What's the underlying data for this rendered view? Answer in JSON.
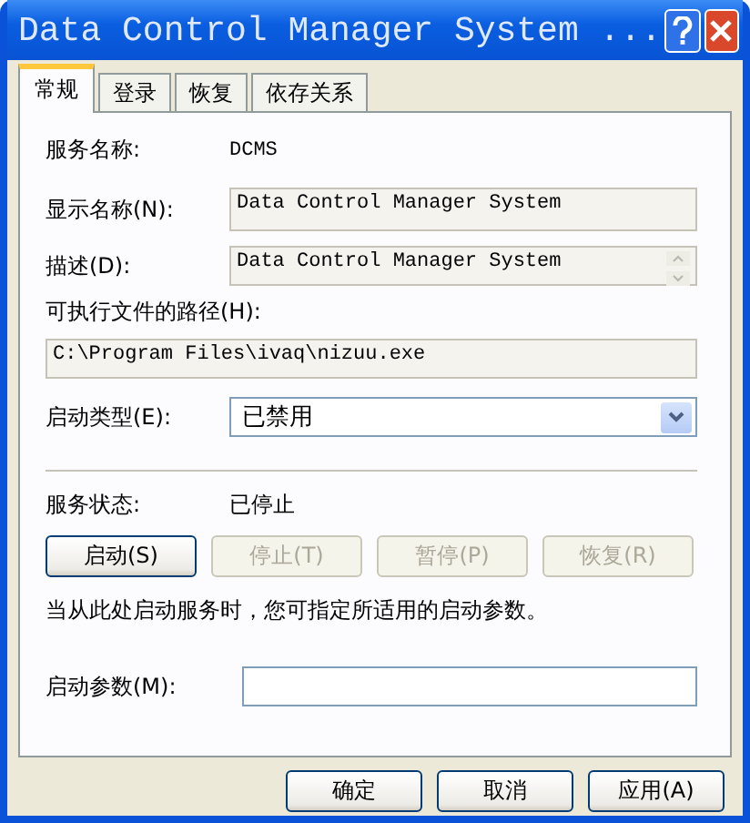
{
  "window": {
    "title": "Data Control Manager System ..."
  },
  "tabs": [
    {
      "label": "常规",
      "selected": true
    },
    {
      "label": "登录",
      "selected": false
    },
    {
      "label": "恢复",
      "selected": false
    },
    {
      "label": "依存关系",
      "selected": false
    }
  ],
  "service_name": {
    "label": "服务名称:",
    "value": "DCMS"
  },
  "display_name": {
    "label": "显示名称(N):",
    "value": "Data Control Manager System"
  },
  "description": {
    "label": "描述(D):",
    "value": "Data Control Manager System"
  },
  "path": {
    "label": "可执行文件的路径(H):",
    "value": "C:\\Program Files\\ivaq\\nizuu.exe"
  },
  "startup_type": {
    "label": "启动类型(E):",
    "value": "已禁用"
  },
  "service_status": {
    "label": "服务状态:",
    "value": "已停止"
  },
  "service_buttons": [
    {
      "label": "启动(S)",
      "disabled": false
    },
    {
      "label": "停止(T)",
      "disabled": true
    },
    {
      "label": "暂停(P)",
      "disabled": true
    },
    {
      "label": "恢复(R)",
      "disabled": true
    }
  ],
  "hint": "当从此处启动服务时，您可指定所适用的启动参数。",
  "start_params": {
    "label": "启动参数(M):"
  },
  "dialog_buttons": [
    {
      "label": "确定",
      "disabled": false
    },
    {
      "label": "取消",
      "disabled": false
    },
    {
      "label": "应用(A)",
      "disabled": false
    }
  ]
}
